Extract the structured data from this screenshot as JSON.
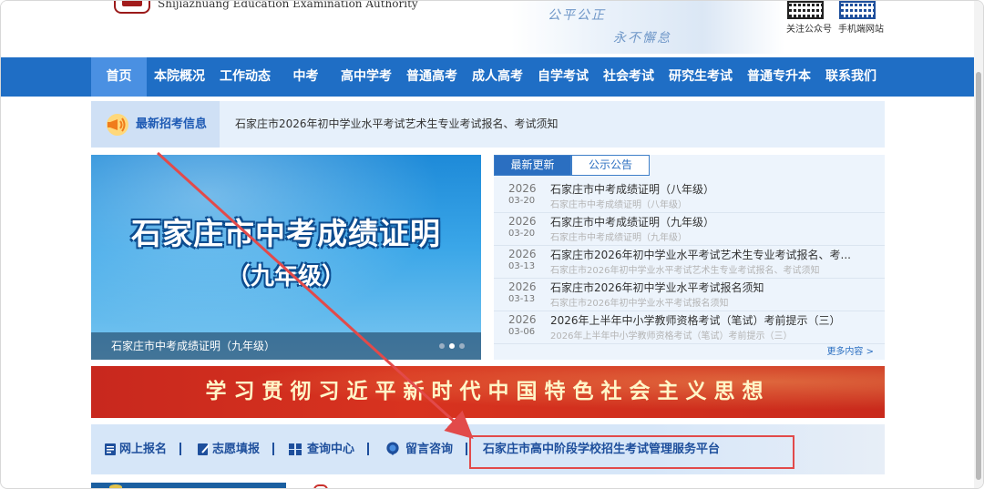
{
  "header": {
    "site_name_en": "Shijiazhuang Education Examination Authority",
    "slogan_1": "公平公正",
    "slogan_2": "永不懈怠",
    "qr_1_label": "关注公众号",
    "qr_2_label": "手机端网站"
  },
  "nav": {
    "items": [
      {
        "label": "首页",
        "active": true
      },
      {
        "label": "本院概况"
      },
      {
        "label": "工作动态"
      },
      {
        "label": "中考"
      },
      {
        "label": "高中学考"
      },
      {
        "label": "普通高考"
      },
      {
        "label": "成人高考"
      },
      {
        "label": "自学考试"
      },
      {
        "label": "社会考试"
      },
      {
        "label": "研究生考试"
      },
      {
        "label": "普通专升本"
      },
      {
        "label": "联系我们"
      }
    ]
  },
  "notice": {
    "title": "最新招考信息",
    "text": "石家庄市2026年初中学业水平考试艺术生专业考试报名、考试须知"
  },
  "slider": {
    "headline": "石家庄市中考成绩证明",
    "subline": "（九年级）",
    "caption": "石家庄市中考成绩证明（九年级）"
  },
  "news": {
    "tab_latest": "最新更新",
    "tab_notice": "公示公告",
    "items": [
      {
        "year": "2026",
        "md": "03-20",
        "title": "石家庄市中考成绩证明（八年级）",
        "sub": "石家庄市中考成绩证明（八年级）"
      },
      {
        "year": "2026",
        "md": "03-20",
        "title": "石家庄市中考成绩证明（九年级）",
        "sub": "石家庄市中考成绩证明（九年级）"
      },
      {
        "year": "2026",
        "md": "03-13",
        "title": "石家庄市2026年初中学业水平考试艺术生专业考试报名、考...",
        "sub": "石家庄市2026年初中学业水平考试艺术生专业考试报名、考试须知"
      },
      {
        "year": "2026",
        "md": "03-13",
        "title": "石家庄市2026年初中学业水平考试报名须知",
        "sub": "石家庄市2026年初中学业水平考试报名须知"
      },
      {
        "year": "2026",
        "md": "03-06",
        "title": "2026年上半年中小学教师资格考试（笔试）考前提示（三）",
        "sub": "2026年上半年中小学教师资格考试（笔试）考前提示（三）"
      }
    ],
    "more": "更多内容 >"
  },
  "banner": {
    "text": "学习贯彻习近平新时代中国特色社会主义思想"
  },
  "quick_links": {
    "online_registration": "网上报名",
    "volunteer_filling": "志愿填报",
    "query_center": "查询中心",
    "message_consult": "留言咨询",
    "highschool_platform": "石家庄市高中阶段学校招生考试管理服务平台"
  },
  "colors": {
    "nav_bg": "#1f6ec5",
    "nav_active": "#4a90e2",
    "banner_red": "#d8331f",
    "link_blue": "#1e4f9c",
    "annotation_red": "#e24a4a"
  }
}
